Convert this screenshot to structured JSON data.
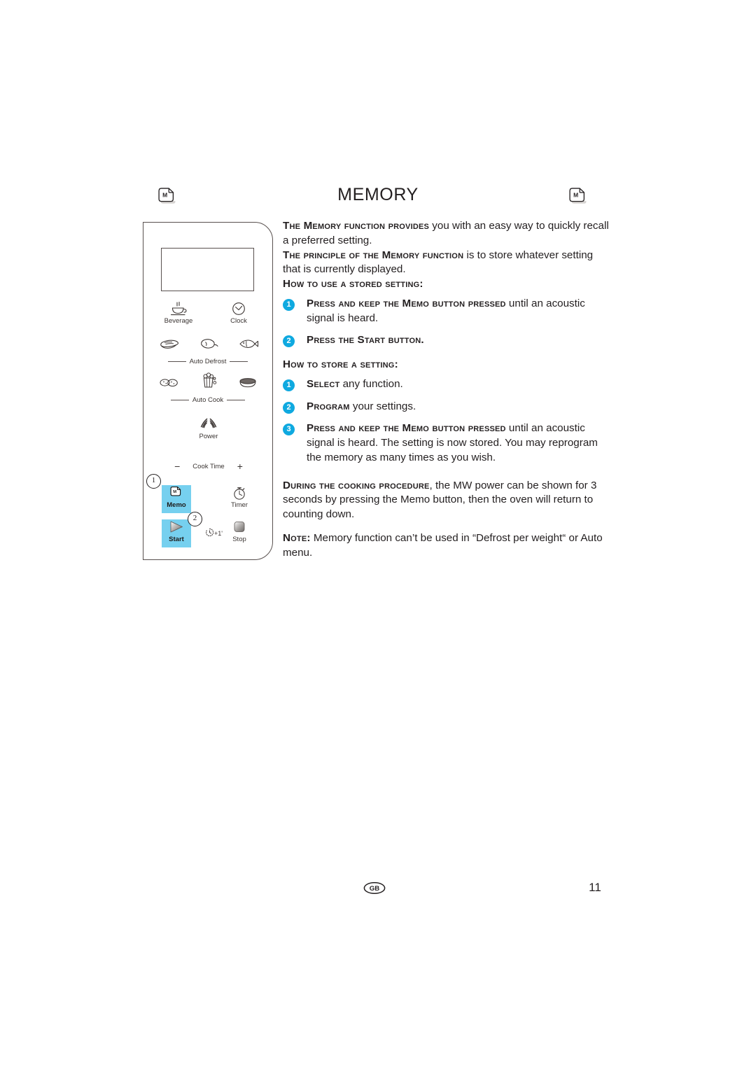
{
  "header": {
    "title": "MEMORY",
    "icon_left": "memo-page-icon",
    "icon_right": "memo-page-icon",
    "icon_letter": "M"
  },
  "panel": {
    "name": "microwave-control-panel",
    "display": "",
    "keys": {
      "beverage": "Beverage",
      "clock": "Clock",
      "auto_defrost_group": "Auto Defrost",
      "auto_defrost_items": [
        "meat-icon",
        "poultry-icon",
        "fish-icon"
      ],
      "auto_cook_group": "Auto Cook",
      "auto_cook_items": [
        "potatoes-icon",
        "popcorn-icon",
        "bowl-icon"
      ],
      "power": "Power",
      "cook_time": "Cook Time",
      "cook_time_minus": "−",
      "cook_time_plus": "+",
      "memo": "Memo",
      "timer": "Timer",
      "start": "Start",
      "stop": "Stop",
      "quick_start": "+1'"
    },
    "callouts": {
      "memo": "1",
      "start": "2"
    }
  },
  "body": {
    "intro": [
      {
        "lead": "The Memory function provides",
        "rest": " you with an easy way to quickly recall a preferred setting."
      },
      {
        "lead": "The principle of the Memory function",
        "rest": " is to store whatever setting that is currently displayed."
      }
    ],
    "use_heading": "How to use a stored setting:",
    "use_steps": [
      {
        "num": "1",
        "lead": "Press and keep the Memo button pressed",
        "rest": " until an acoustic signal is heard."
      },
      {
        "num": "2",
        "lead": "Press the Start button.",
        "rest": ""
      }
    ],
    "store_heading": "How to store a setting:",
    "store_steps": [
      {
        "num": "1",
        "lead": "Select",
        "rest": " any function."
      },
      {
        "num": "2",
        "lead": "Program",
        "rest": " your settings."
      },
      {
        "num": "3",
        "lead": "Press and keep the Memo button pressed",
        "rest": " until an acoustic signal is heard. The setting is now stored.  You may reprogram the memory as many times as you wish."
      }
    ],
    "during": {
      "lead": "During the cooking procedure",
      "rest": ", the MW power can be shown for 3 seconds by pressing the Memo button, then the oven will return to counting down."
    },
    "note": {
      "lead": "Note:",
      "rest": " Memory function can’t be used in “Defrost per weight“ or Auto menu."
    }
  },
  "footer": {
    "language_badge": "GB",
    "page_number": "11"
  },
  "colors": {
    "accent_bullet": "#0fa9e0",
    "key_highlight": "#76d0ef",
    "ink": "#231f20",
    "line": "#58504e"
  }
}
